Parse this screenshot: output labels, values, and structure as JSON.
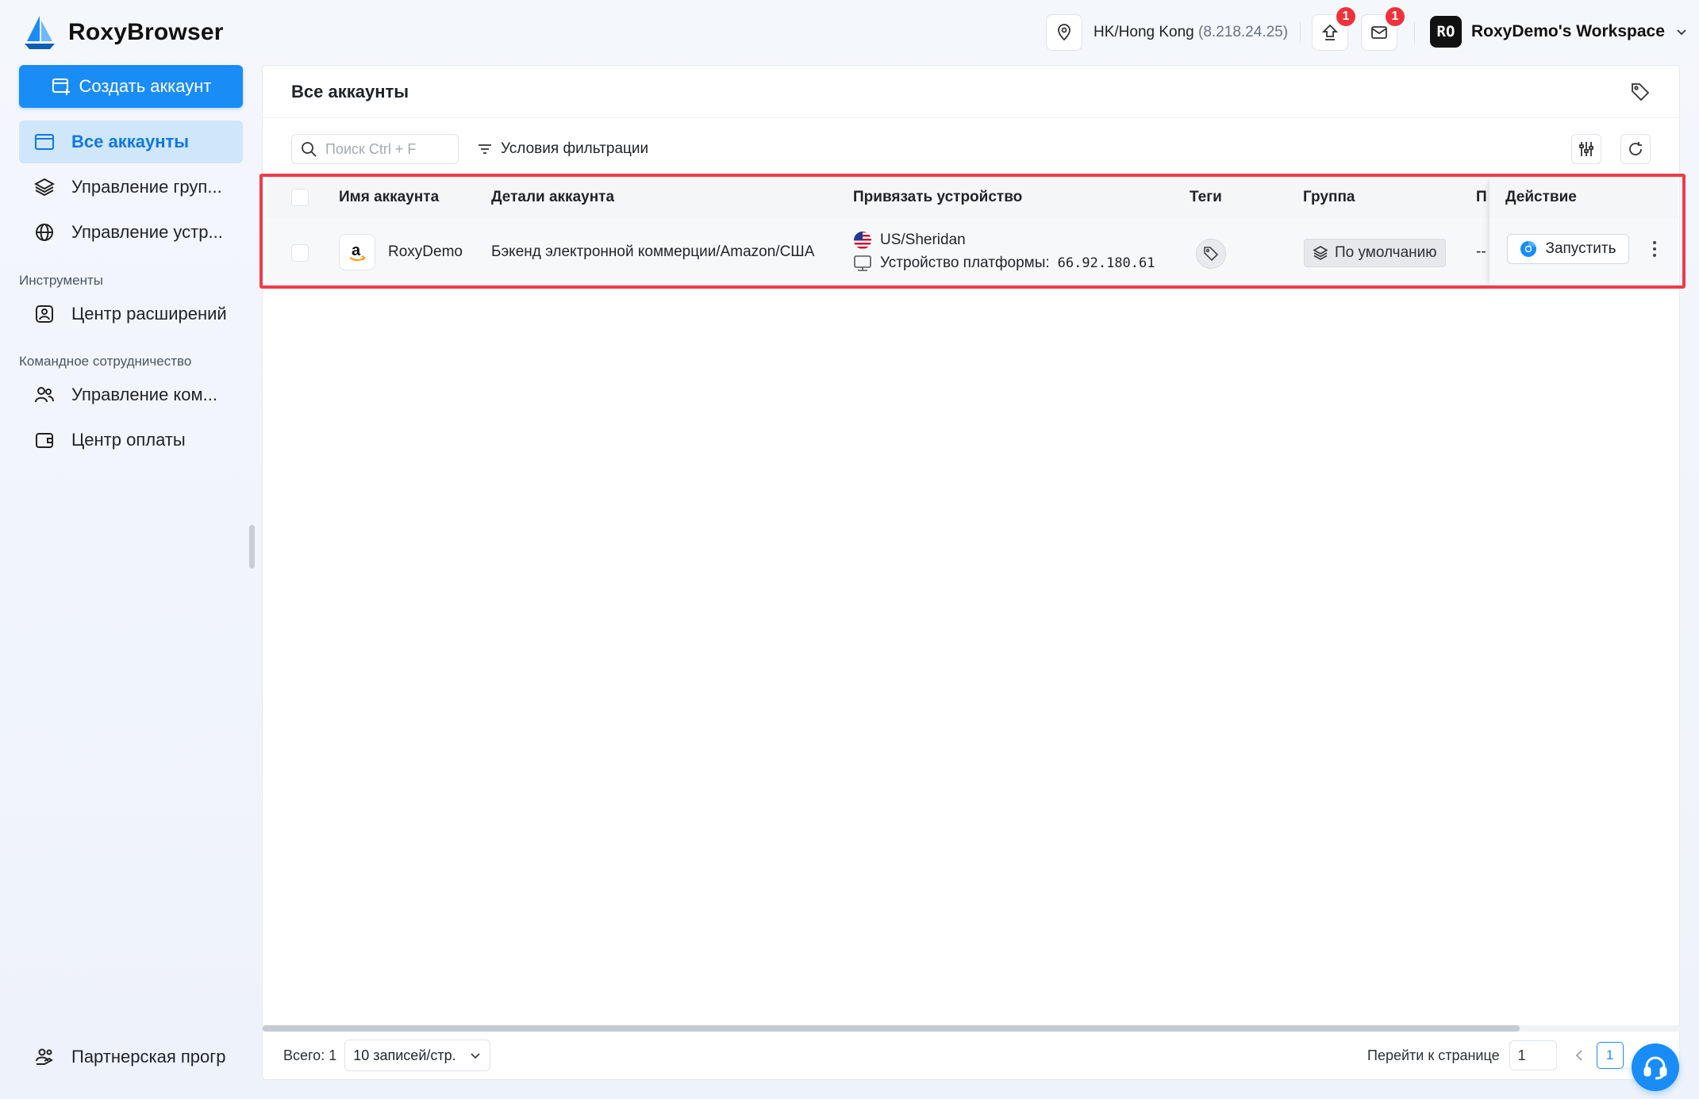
{
  "app": {
    "name": "RoxyBrowser",
    "brand_color": "#1a8cf6"
  },
  "topbar": {
    "location_label": "HK/Hong Kong",
    "location_ip": "(8.218.24.25)",
    "update_badge": "1",
    "mail_badge": "1",
    "workspace_avatar": "RO",
    "workspace_name": "RoxyDemo's Workspace"
  },
  "sidebar": {
    "create_button": "Создать аккаунт",
    "items": [
      {
        "label": "Все аккаунты",
        "icon": "browser-window-icon",
        "active": true
      },
      {
        "label": "Управление груп...",
        "icon": "layers-icon"
      },
      {
        "label": "Управление устр...",
        "icon": "globe-icon"
      }
    ],
    "section_tools": "Инструменты",
    "tools_items": [
      {
        "label": "Центр расширений",
        "icon": "extension-icon"
      }
    ],
    "section_team": "Командное сотрудничество",
    "team_items": [
      {
        "label": "Управление ком...",
        "icon": "team-icon"
      },
      {
        "label": "Центр оплаты",
        "icon": "wallet-icon"
      }
    ],
    "partner": {
      "label": "Партнерская прогр",
      "icon": "partner-icon"
    }
  },
  "main": {
    "title": "Все аккаунты",
    "search_placeholder": "Поиск Ctrl + F",
    "filter_label": "Условия фильтрации"
  },
  "table": {
    "columns": [
      "Имя аккаунта",
      "Детали аккаунта",
      "Привязать устройство",
      "Теги",
      "Группа",
      "П",
      "Действие"
    ],
    "rows": [
      {
        "name": "RoxyDemo",
        "details": "Бэкенд электронной коммерции/Amazon/США",
        "device_location": "US/Sheridan",
        "device_label": "Устройство платформы:",
        "device_ip": "66.92.180.61",
        "group": "По умолчанию",
        "p_value": "--",
        "launch_label": "Запустить"
      }
    ]
  },
  "footer": {
    "total": "Всего: 1",
    "page_size": "10 записей/стр.",
    "goto_label": "Перейти к странице",
    "goto_value": "1",
    "current_page": "1"
  }
}
